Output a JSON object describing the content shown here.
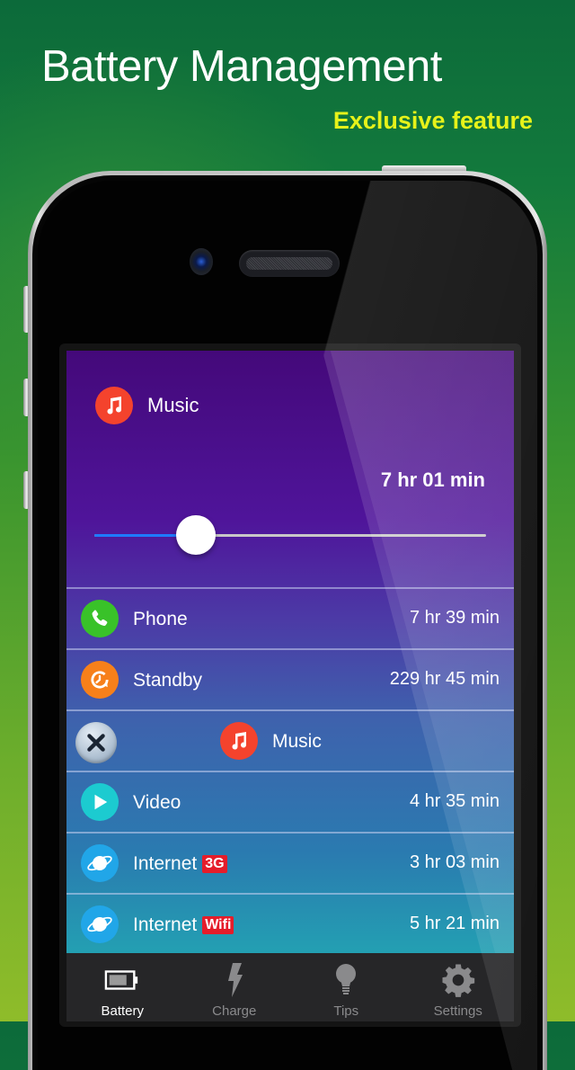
{
  "promo": {
    "title": "Battery Management",
    "subtitle": "Exclusive feature"
  },
  "colors": {
    "accent_blue": "#1f7bff",
    "badge_red": "#e51d2a",
    "subtitle_yellow": "#e6f21a"
  },
  "hero": {
    "icon": "music-note-icon",
    "label": "Music",
    "time": "7 hr 01 min",
    "slider_fraction": 0.26
  },
  "rows": [
    {
      "icon": "phone-icon",
      "icon_color": "#39c229",
      "label": "Phone",
      "badge": null,
      "value": "7 hr 39 min"
    },
    {
      "icon": "standby-clock-icon",
      "icon_color": "#f7801a",
      "label": "Standby",
      "badge": null,
      "value": "229 hr 45 min"
    },
    {
      "icon": "music-note-icon",
      "icon_color": "#f4432d",
      "label": "Music",
      "badge": null,
      "value": "",
      "swiped": true,
      "delete_icon": "close-x-icon"
    },
    {
      "icon": "play-icon",
      "icon_color": "#1ccbd0",
      "label": "Video",
      "badge": null,
      "value": "4 hr 35 min"
    },
    {
      "icon": "planet-icon",
      "icon_color": "#21a6e8",
      "label": "Internet",
      "badge": "3G",
      "value": "3 hr 03 min"
    },
    {
      "icon": "planet-icon",
      "icon_color": "#21a6e8",
      "label": "Internet",
      "badge": "Wifi",
      "value": "5 hr 21 min"
    }
  ],
  "tabs": [
    {
      "icon": "battery-icon",
      "label": "Battery",
      "active": true
    },
    {
      "icon": "lightning-icon",
      "label": "Charge",
      "active": false
    },
    {
      "icon": "lightbulb-icon",
      "label": "Tips",
      "active": false
    },
    {
      "icon": "gear-icon",
      "label": "Settings",
      "active": false
    }
  ]
}
